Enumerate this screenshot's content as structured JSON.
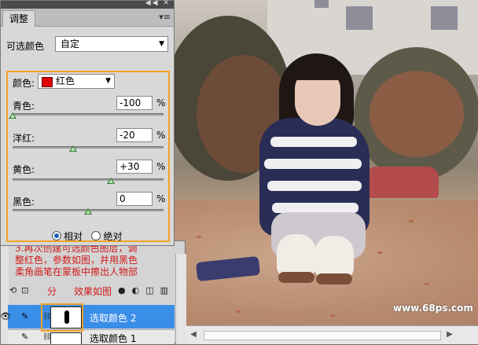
{
  "adjustments": {
    "tab_label": "调整",
    "preset_label": "可选颜色",
    "preset_value": "自定",
    "colors_label": "颜色:",
    "colors_value": "红色",
    "swatch_color": "#e00000",
    "sliders": [
      {
        "label": "青色:",
        "value": "-100",
        "unit": "%",
        "level": 0
      },
      {
        "label": "洋红:",
        "value": "-20",
        "unit": "%",
        "level": 0.4
      },
      {
        "label": "黄色:",
        "value": "+30",
        "unit": "%",
        "level": 0.65
      },
      {
        "label": "黑色:",
        "value": "0",
        "unit": "%",
        "level": 0.5
      }
    ],
    "method_relative": "相对",
    "method_absolute": "绝对",
    "method_selected": "relative"
  },
  "annotation": {
    "lines": [
      "3.再次创建可选颜色图层，调",
      "整红色，参数如图，并用黑色",
      "柔角画笔在蒙板中擦出人物部"
    ],
    "tail_a": "分",
    "tail_b": "效果如图"
  },
  "layers": {
    "rows": [
      {
        "name": "选取颜色 2",
        "selected": true
      },
      {
        "name": "选取颜色 1",
        "selected": false
      }
    ]
  },
  "watermark": "www.68ps.com",
  "accent_color": "#f3a226",
  "annotation_color": "#d11a1a"
}
